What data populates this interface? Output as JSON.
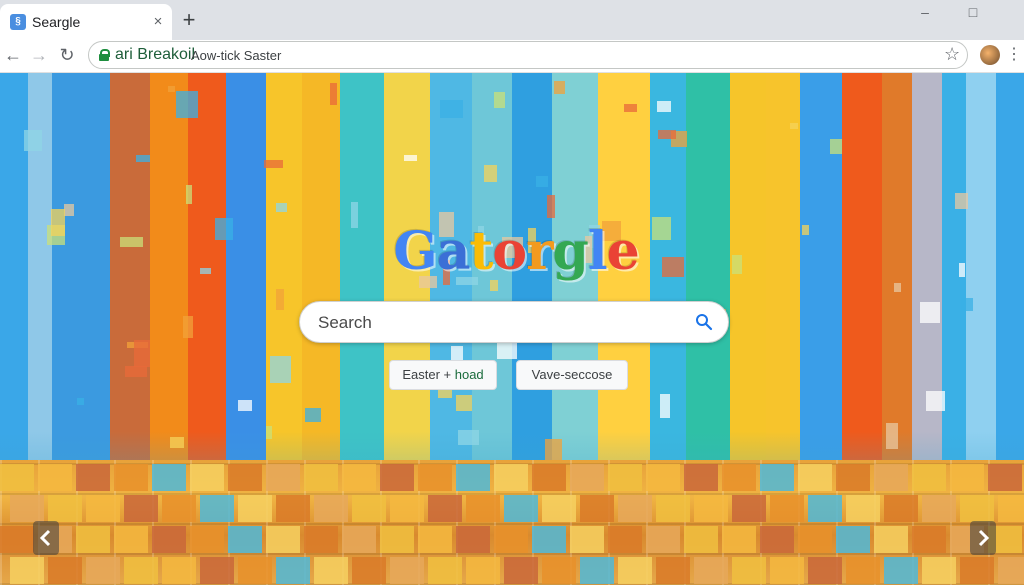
{
  "browser": {
    "tab": {
      "title": "Seargle",
      "favicon": "page-favicon",
      "close": "×"
    },
    "new_tab": "+",
    "window_controls": {
      "minimize": "–",
      "maximize": "□"
    },
    "nav": {
      "back": "←",
      "forward": "→",
      "reload": "↻"
    },
    "omnibox": {
      "site_name": "ari Breakoil",
      "url": "Aow-tick Saster"
    },
    "bookmark": "☆",
    "menu": "⋮"
  },
  "page": {
    "logo": {
      "letters": [
        "G",
        "a",
        "t",
        "o",
        "r",
        "g",
        "l",
        "e"
      ],
      "colors": [
        "#4285f4",
        "#3b6fd6",
        "#fbbc05",
        "#ea4335",
        "#f29a1f",
        "#34a853",
        "#4285f4",
        "#ea4335"
      ]
    },
    "search": {
      "placeholder": "Search",
      "icon": "magnifier-icon"
    },
    "buttons": {
      "left_a": "Easter + ",
      "left_b": "hoad",
      "right": "Vave-seccose"
    },
    "arrows": {
      "left": "chevron-left-icon",
      "right": "chevron-right-icon"
    }
  }
}
